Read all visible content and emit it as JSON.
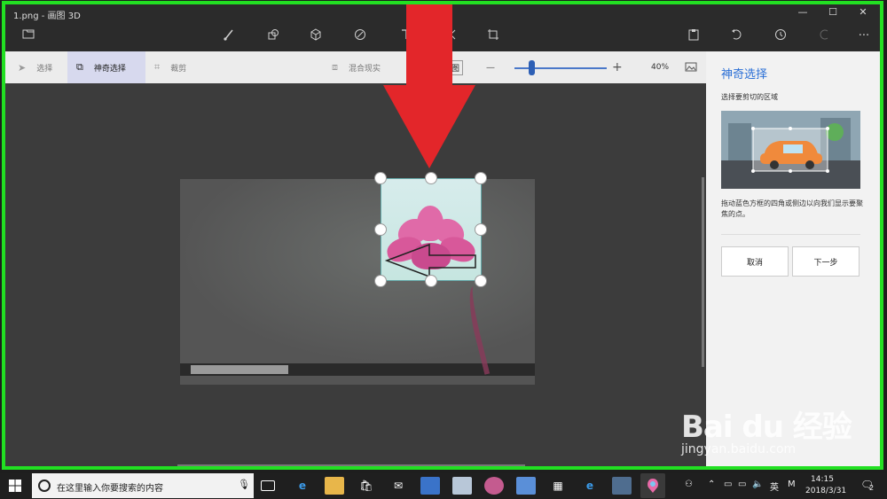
{
  "window": {
    "title": "1.png - 画图 3D",
    "minimize": "—",
    "maximize": "☐",
    "close": "✕"
  },
  "toolbar": {
    "icons": [
      "folder-icon",
      "brush-icon",
      "2d-shapes-icon",
      "3d-shapes-icon",
      "stickers-icon",
      "text-icon",
      "effects-icon",
      "canvas-icon",
      "paste-icon",
      "undo-icon",
      "history-icon",
      "redo-icon",
      "more-icon"
    ],
    "more": "···"
  },
  "subbar": {
    "select": "选择",
    "magic_select": "神奇选择",
    "crop": "裁剪",
    "mixed_reality": "混合现实",
    "view_3d": "3D 视图",
    "zoom_minus": "—",
    "zoom_plus": "+",
    "zoom_level": "40%"
  },
  "panel": {
    "title": "神奇选择",
    "subtitle": "选择要剪切的区域",
    "description": "拖动蓝色方框的四角或侧边以向我们显示要聚焦的点。",
    "cancel": "取消",
    "next": "下一步"
  },
  "watermark": {
    "main": "Bai du 经验",
    "url": "jingyan.baidu.com"
  },
  "taskbar": {
    "search_placeholder": "在这里输入你要搜索的内容",
    "tray_lang": "英",
    "tray_ime": "M",
    "time": "14:15",
    "date": "2018/3/31",
    "notification_count": "2"
  },
  "colors": {
    "accent": "#2a6fd6",
    "annotation_green": "#22e022",
    "annotation_red": "#e3262a"
  }
}
